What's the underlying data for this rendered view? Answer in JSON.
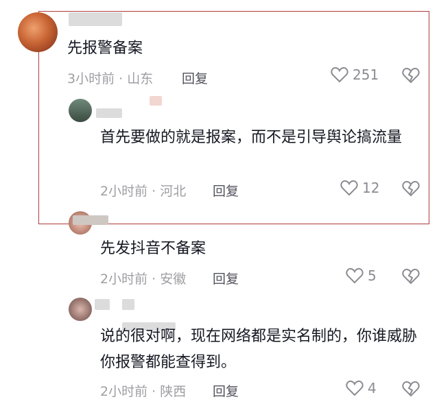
{
  "comments": [
    {
      "text": "先报警备案",
      "time": "3小时前 · 山东",
      "reply": "回复",
      "likes": "251"
    },
    {
      "text": "首先要做的就是报案，而不是引导舆论搞流量",
      "time": "2小时前 · 河北",
      "reply": "回复",
      "likes": "12"
    },
    {
      "text": "先发抖音不备案",
      "time": "2小时前 · 安徽",
      "reply": "回复",
      "likes": "5"
    },
    {
      "text": "说的很对啊，现在网络都是实名制的，你谁威胁你报警都能查得到。",
      "time": "2小时前 · 陕西",
      "reply": "回复",
      "likes": "4"
    }
  ],
  "colors": {
    "highlight": "#b03a3a",
    "meta": "#9e9ea3",
    "like": "#8a8b91"
  },
  "icons": {
    "like": "heart-outline-icon",
    "dislike": "broken-heart-icon"
  }
}
